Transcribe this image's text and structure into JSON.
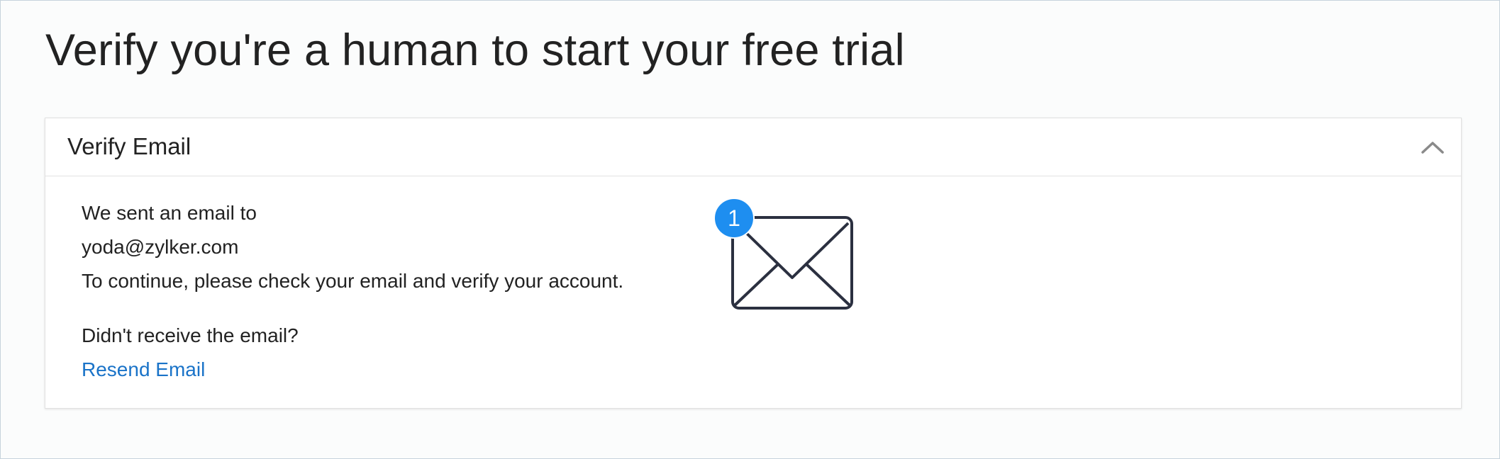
{
  "page": {
    "title": "Verify you're a human to start your free trial"
  },
  "card": {
    "title": "Verify Email",
    "collapse_icon": "chevron-up-icon",
    "message": {
      "line1": "We sent an email to",
      "email": "yoda@zylker.com",
      "line3": "To continue, please check your email and verify your account."
    },
    "resend": {
      "question": "Didn't receive the email?",
      "link_label": "Resend Email"
    },
    "illustration": {
      "icon": "envelope-icon",
      "badge_count": "1"
    }
  },
  "colors": {
    "link": "#1a73c8",
    "badge": "#1e8ef0",
    "text": "#222222",
    "envelope_stroke": "#2b3040"
  }
}
